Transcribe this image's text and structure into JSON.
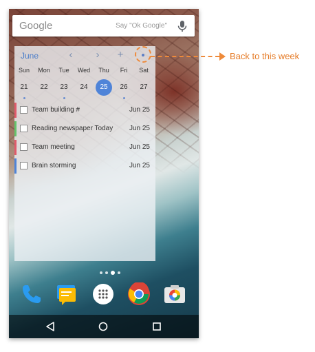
{
  "search": {
    "logo": "Google",
    "hint": "Say \"Ok Google\""
  },
  "calendar": {
    "month": "June",
    "nav_prev": "‹",
    "nav_next": "›",
    "add": "+",
    "days": [
      "Sun",
      "Mon",
      "Tue",
      "Wed",
      "Thu",
      "Fri",
      "Sat"
    ],
    "dates": [
      "21",
      "22",
      "23",
      "24",
      "25",
      "26",
      "27"
    ],
    "selected_index": 4,
    "events": [
      {
        "title": "Team building #",
        "date": "Jun 25",
        "color": "#e05a6b"
      },
      {
        "title": "Reading newspaper Today",
        "date": "Jun 25",
        "color": "#64c36b"
      },
      {
        "title": "Team meeting",
        "date": "Jun 25",
        "color": "#e05a6b"
      },
      {
        "title": "Brain storming",
        "date": "Jun 25",
        "color": "#4f84d8"
      }
    ]
  },
  "callout": {
    "text": "Back to this week",
    "color": "#ee8a3a"
  },
  "dock": [
    "phone-icon",
    "messenger-icon",
    "apps-icon",
    "chrome-icon",
    "camera-icon"
  ],
  "nav": [
    "back-icon",
    "home-icon",
    "recents-icon"
  ]
}
